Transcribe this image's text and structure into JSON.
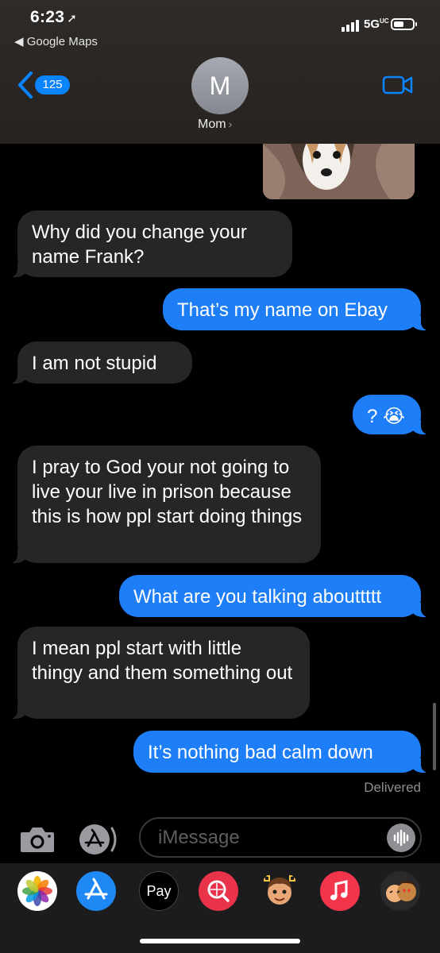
{
  "status_bar": {
    "time": "6:23",
    "back_app": "◀ Google Maps",
    "network": "5G",
    "network_sup": "UC"
  },
  "nav": {
    "unread_count": "125",
    "avatar_initial": "M",
    "contact_name": "Mom",
    "accent_color": "#0a84ff"
  },
  "messages": [
    {
      "side": "in",
      "text": "Why did you change your name Frank?"
    },
    {
      "side": "out",
      "text": "That’s my name on Ebay"
    },
    {
      "side": "in",
      "text": "I am not stupid"
    },
    {
      "side": "out",
      "text": "? 😭"
    },
    {
      "side": "in",
      "text": "I pray to God your not going to live your live in prison because this is how ppl start doing things"
    },
    {
      "side": "out",
      "text": "What are you talking abouttttt"
    },
    {
      "side": "in",
      "text": "I mean ppl start with little thingy and them something out"
    },
    {
      "side": "out",
      "text": "It’s nothing bad calm down"
    }
  ],
  "delivered_label": "Delivered",
  "compose": {
    "placeholder": "iMessage"
  },
  "app_drawer": {
    "apple_pay_label": "Pay",
    "icons": [
      "photos-icon",
      "app-store-icon",
      "apple-pay-icon",
      "web-search-icon",
      "memoji-icon",
      "music-icon",
      "memoji-stickers-icon"
    ]
  }
}
